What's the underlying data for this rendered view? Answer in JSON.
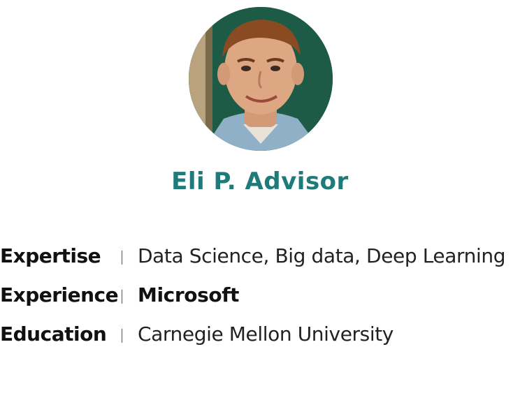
{
  "advisor": {
    "name": "Eli P. Advisor",
    "name_color": "#1f7a7a",
    "photo": "portrait-photo"
  },
  "details": [
    {
      "label": "Expertise",
      "value": "Data Science, Big data, Deep Learning"
    },
    {
      "label": "Experience",
      "value": "Microsoft"
    },
    {
      "label": "Education",
      "value": "Carnegie Mellon University"
    }
  ]
}
